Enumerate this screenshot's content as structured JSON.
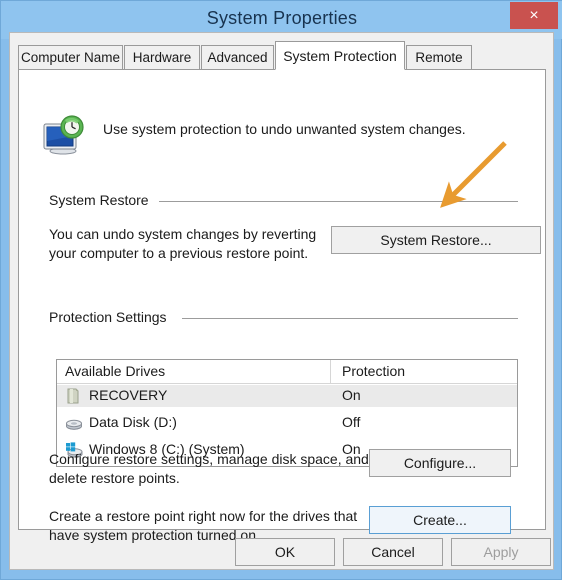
{
  "window": {
    "title": "System Properties",
    "close_label": "×",
    "accent_titlebar": "#8fc4ef",
    "accent_close": "#c9524f",
    "annotation_arrow_color": "#e89b30"
  },
  "tabs": [
    {
      "label": "Computer Name",
      "active": false
    },
    {
      "label": "Hardware",
      "active": false
    },
    {
      "label": "Advanced",
      "active": false
    },
    {
      "label": "System Protection",
      "active": true
    },
    {
      "label": "Remote",
      "active": false
    }
  ],
  "header": {
    "icon": "system-protection-icon",
    "description": "Use system protection to undo unwanted system changes."
  },
  "system_restore": {
    "group_label": "System Restore",
    "description_line1": "You can undo system changes by reverting",
    "description_line2": "your computer to a previous restore point.",
    "button_label": "System Restore..."
  },
  "protection_settings": {
    "group_label": "Protection Settings",
    "columns": [
      "Available Drives",
      "Protection"
    ],
    "rows": [
      {
        "icon": "recovery-drive-icon",
        "name": "RECOVERY",
        "protection": "On",
        "selected": true
      },
      {
        "icon": "hard-disk-icon",
        "name": "Data Disk (D:)",
        "protection": "Off",
        "selected": false
      },
      {
        "icon": "windows-system-disk-icon",
        "name": "Windows 8 (C:) (System)",
        "protection": "On",
        "selected": false
      }
    ],
    "configure": {
      "description_line1": "Configure restore settings, manage disk space, and",
      "description_line2": "delete restore points.",
      "button_label": "Configure..."
    },
    "create": {
      "description_line1": "Create a restore point right now for the drives that",
      "description_line2": "have system protection turned on.",
      "button_label": "Create..."
    }
  },
  "footer": {
    "ok_label": "OK",
    "cancel_label": "Cancel",
    "apply_label": "Apply",
    "apply_disabled": true
  }
}
